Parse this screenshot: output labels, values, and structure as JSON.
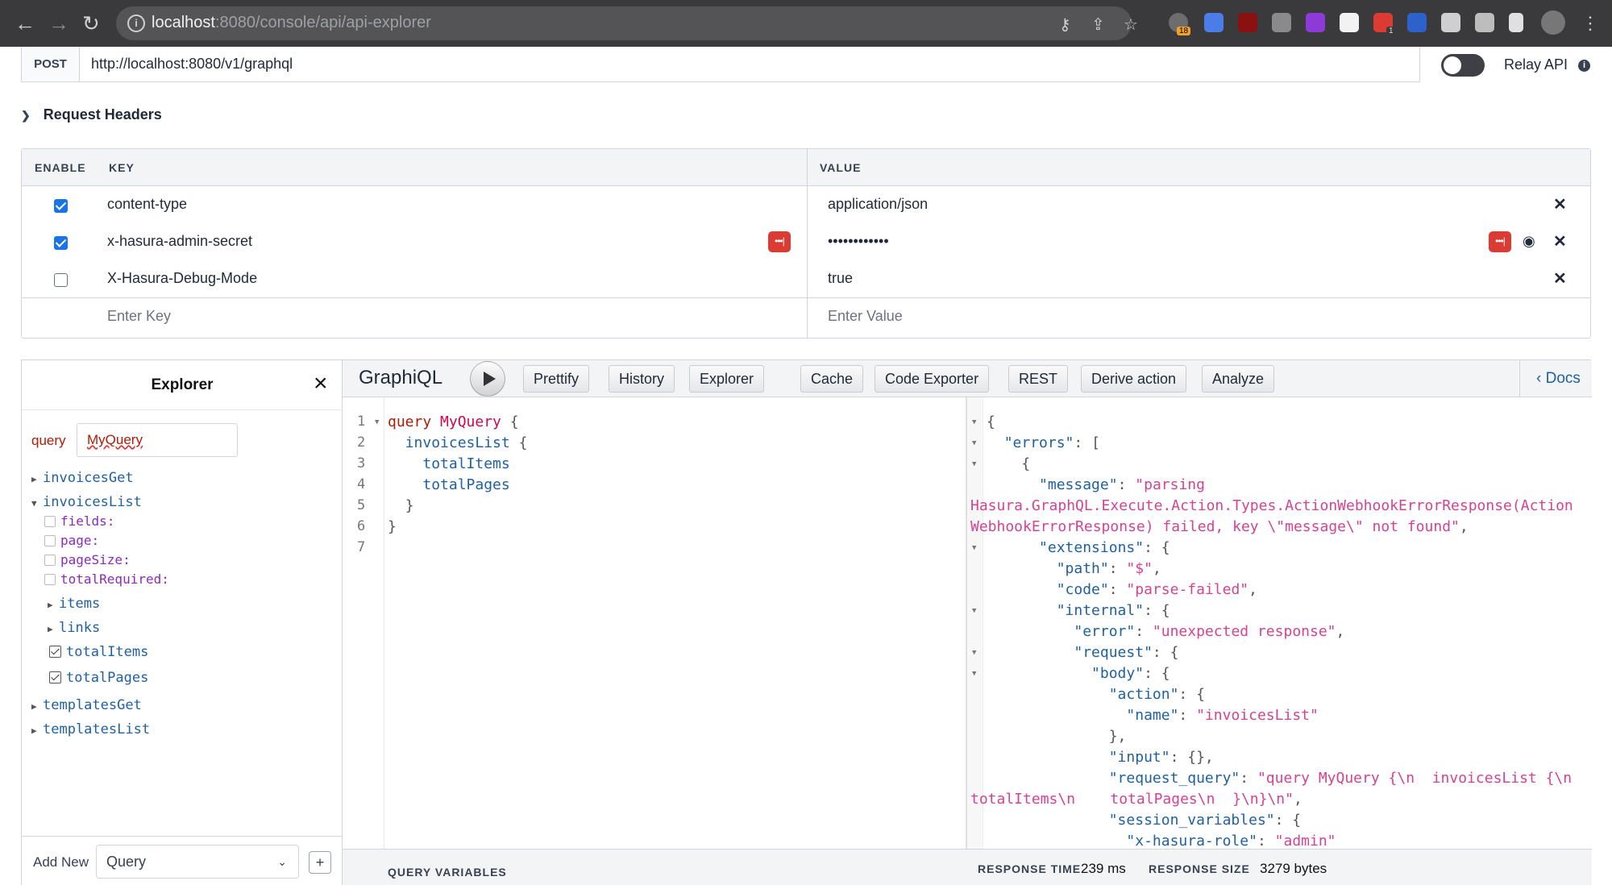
{
  "browser": {
    "url_host": "localhost",
    "url_rest": ":8080/console/api/api-explorer",
    "extension_badge": "18",
    "extension_badge2": "1"
  },
  "endpoint": {
    "method": "POST",
    "url": "http://localhost:8080/v1/graphql",
    "relay_label": "Relay API",
    "relay_enabled": false
  },
  "request_headers": {
    "title": "Request Headers",
    "columns": {
      "enable": "ENABLE",
      "key": "KEY",
      "value": "VALUE"
    },
    "rows": [
      {
        "enabled": true,
        "key": "content-type",
        "value": "application/json"
      },
      {
        "enabled": true,
        "key": "x-hasura-admin-secret",
        "value": "••••••••••••"
      },
      {
        "enabled": false,
        "key": "X-Hasura-Debug-Mode",
        "value": "true"
      }
    ],
    "key_placeholder": "Enter Key",
    "value_placeholder": "Enter Value"
  },
  "explorer": {
    "title": "Explorer",
    "operation_keyword": "query",
    "operation_name": "MyQuery",
    "items": {
      "invoicesGet": "invoicesGet",
      "invoicesList": "invoicesList",
      "arg_fields": "fields:",
      "arg_page": "page:",
      "arg_pageSize": "pageSize:",
      "arg_totalRequired": "totalRequired:",
      "items": "items",
      "links": "links",
      "totalItems": "totalItems",
      "totalPages": "totalPages",
      "templatesGet": "templatesGet",
      "templatesList": "templatesList"
    },
    "add_new_label": "Add New",
    "add_new_selected": "Query",
    "add_button": "+"
  },
  "toolbar": {
    "title": "GraphiQL",
    "buttons": [
      "Prettify",
      "History",
      "Explorer",
      "Cache",
      "Code Exporter",
      "REST",
      "Derive action",
      "Analyze"
    ],
    "docs": "Docs"
  },
  "query_editor": {
    "line_numbers": [
      "1",
      "2",
      "3",
      "4",
      "5",
      "6",
      "7"
    ]
  },
  "query_variables_label": "QUERY VARIABLES",
  "response": {
    "time_label": "RESPONSE TIME",
    "time_value": "239 ms",
    "size_label": "RESPONSE SIZE",
    "size_value": "3279 bytes"
  }
}
